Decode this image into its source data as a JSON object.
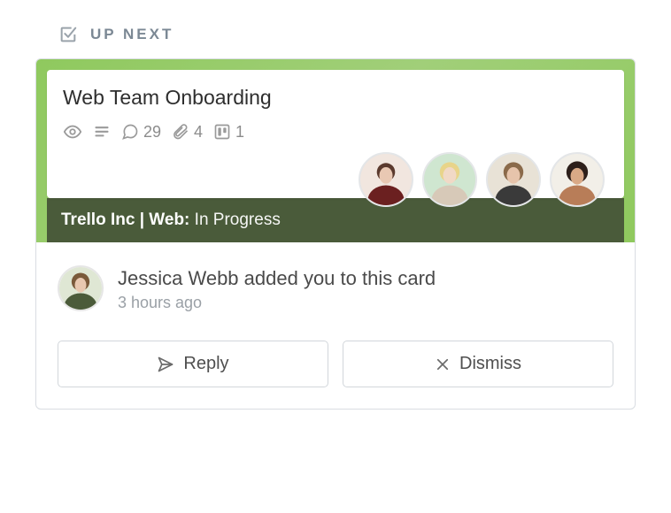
{
  "header": {
    "title": "UP NEXT"
  },
  "card": {
    "title": "Web Team Onboarding",
    "badges": {
      "comments": 29,
      "attachments": 4,
      "boards": 1
    },
    "members": [
      {
        "name": "member-1"
      },
      {
        "name": "member-2"
      },
      {
        "name": "member-3"
      },
      {
        "name": "member-4"
      }
    ]
  },
  "board": {
    "prefix": "Trello Inc | Web:",
    "list": "In Progress"
  },
  "activity": {
    "message": "Jessica Webb added you to this card",
    "time": "3 hours ago"
  },
  "actions": {
    "reply": "Reply",
    "dismiss": "Dismiss"
  }
}
